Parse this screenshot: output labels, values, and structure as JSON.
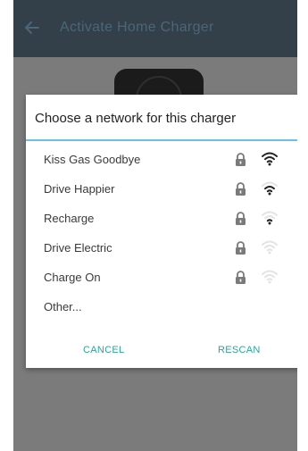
{
  "appbar": {
    "title": "Activate Home Charger",
    "back_icon": "arrow-left-icon"
  },
  "dialog": {
    "title": "Choose a network for this charger",
    "networks": [
      {
        "label": "Kiss Gas Goodbye",
        "secured": true,
        "signal_level": 1.0
      },
      {
        "label": "Drive Happier",
        "secured": true,
        "signal_level": 0.66
      },
      {
        "label": "Recharge",
        "secured": true,
        "signal_level": 0.33
      },
      {
        "label": "Drive Electric",
        "secured": true,
        "signal_level": 0.0
      },
      {
        "label": "Charge On",
        "secured": true,
        "signal_level": 0.0
      },
      {
        "label": "Other..."
      }
    ],
    "cancel_label": "CANCEL",
    "rescan_label": "RESCAN"
  },
  "colors": {
    "appbar": "#33404a",
    "overlay": "#7b7b7b",
    "accent_divider": "#6fbfe0",
    "button_text": "#2aa59a",
    "wifi_active": "#222222",
    "wifi_inactive": "#e3e3e3"
  }
}
